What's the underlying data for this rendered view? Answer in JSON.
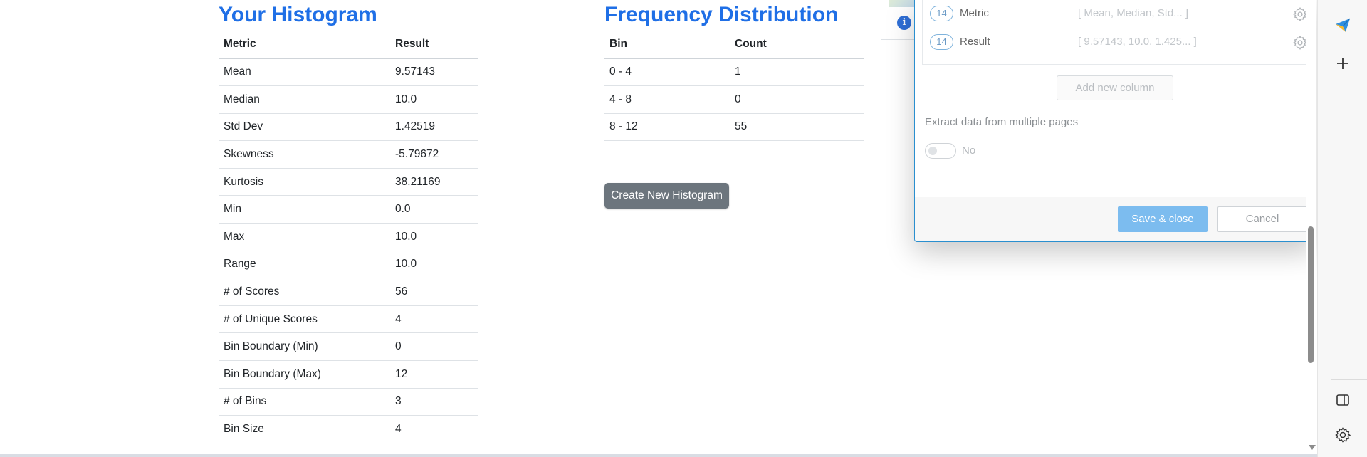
{
  "histogram": {
    "title": "Your Histogram",
    "columns": [
      "Metric",
      "Result"
    ],
    "rows": [
      [
        "Mean",
        "9.57143"
      ],
      [
        "Median",
        "10.0"
      ],
      [
        "Std Dev",
        "1.42519"
      ],
      [
        "Skewness",
        "-5.79672"
      ],
      [
        "Kurtosis",
        "38.21169"
      ],
      [
        "Min",
        "0.0"
      ],
      [
        "Max",
        "10.0"
      ],
      [
        "Range",
        "10.0"
      ],
      [
        "# of Scores",
        "56"
      ],
      [
        "# of Unique Scores",
        "4"
      ],
      [
        "Bin Boundary (Min)",
        "0"
      ],
      [
        "Bin Boundary (Max)",
        "12"
      ],
      [
        "# of Bins",
        "3"
      ],
      [
        "Bin Size",
        "4"
      ]
    ]
  },
  "frequency": {
    "title": "Frequency Distribution",
    "columns": [
      "Bin",
      "Count"
    ],
    "rows": [
      [
        "0 - 4",
        "1"
      ],
      [
        "4 - 8",
        "0"
      ],
      [
        "8 - 12",
        "55"
      ]
    ],
    "create_button": "Create New Histogram"
  },
  "behind_panel": {
    "info_icon": "i"
  },
  "modal": {
    "columns": [
      {
        "count": "14",
        "name": "Metric",
        "preview": "[ Mean, Median, Std...  ]",
        "icon": "gear-icon"
      },
      {
        "count": "14",
        "name": "Result",
        "preview": "[ 9.57143, 10.0, 1.425...  ]",
        "icon": "gear-icon"
      }
    ],
    "add_column": "Add new column",
    "extract_label": "Extract data from multiple pages",
    "toggle_value": "No",
    "save": "Save & close",
    "cancel": "Cancel",
    "colors": {
      "accent": "#7cbcef",
      "border": "#2a8fcf"
    }
  },
  "sidebar": {
    "icons": [
      "send-icon",
      "plus-icon",
      "sidebar-panel-icon",
      "gear-icon"
    ]
  },
  "colors": {
    "title": "#1f6fe6",
    "button": "#6c757d"
  }
}
